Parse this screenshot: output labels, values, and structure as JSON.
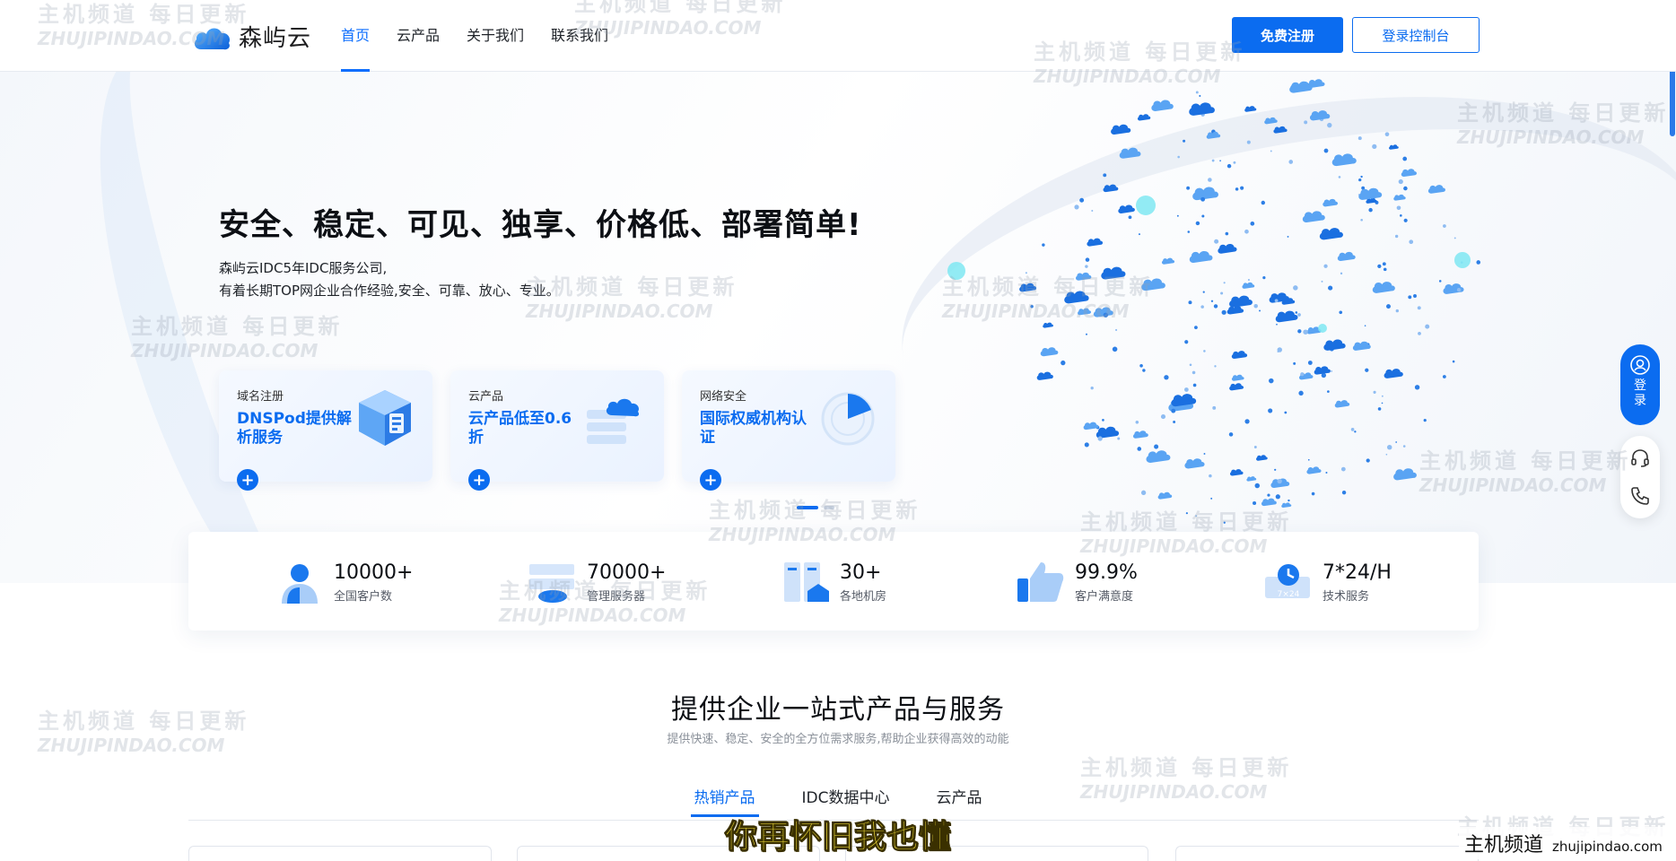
{
  "header": {
    "logo_text": "森屿云",
    "nav": [
      {
        "label": "首页",
        "active": true
      },
      {
        "label": "云产品",
        "active": false
      },
      {
        "label": "关于我们",
        "active": false
      },
      {
        "label": "联系我们",
        "active": false
      }
    ],
    "register_label": "免费注册",
    "console_label": "登录控制台"
  },
  "hero": {
    "title": "安全、稳定、可见、独享、价格低、部署简单!",
    "subtitle_line1": "森屿云IDC5年IDC服务公司,",
    "subtitle_line2": "有着长期TOP网企业合作经验,安全、可靠、放心、专业。",
    "cards": [
      {
        "category": "域名注册",
        "title": "DNSPod提供解析服务",
        "icon": "server-box-icon"
      },
      {
        "category": "云产品",
        "title": "云产品低至0.6折",
        "icon": "cloud-server-icon"
      },
      {
        "category": "网络安全",
        "title": "国际权威机构认证",
        "icon": "radar-shield-icon"
      }
    ]
  },
  "stats": [
    {
      "value": "10000+",
      "label": "全国客户数",
      "icon": "customer-icon"
    },
    {
      "value": "70000+",
      "label": "管理服务器",
      "icon": "server-icon"
    },
    {
      "value": "30+",
      "label": "各地机房",
      "icon": "datacenter-icon"
    },
    {
      "value": "99.9%",
      "label": "客户满意度",
      "icon": "thumbs-up-icon"
    },
    {
      "value": "7*24/H",
      "label": "技术服务",
      "icon": "clock-service-icon"
    }
  ],
  "section": {
    "title": "提供企业一站式产品与服务",
    "subtitle": "提供快速、稳定、安全的全方位需求服务,帮助企业获得高效的动能",
    "tabs": [
      {
        "label": "热销产品",
        "active": true
      },
      {
        "label": "IDC数据中心",
        "active": false
      },
      {
        "label": "云产品",
        "active": false
      }
    ]
  },
  "side": {
    "login_label": "登录",
    "icons": [
      "headset-icon",
      "phone-icon"
    ]
  },
  "overlay": {
    "subtitle_caption": "你再怀旧我也懂",
    "brand_cn": "主机频道",
    "brand_en": "zhujipindao.com",
    "watermark_cn": "主机频道 每日更新",
    "watermark_en": "ZHUJIPINDAO.COM"
  },
  "colors": {
    "accent": "#0b6cf0",
    "text": "#0c0f14",
    "muted": "#8a9099"
  }
}
